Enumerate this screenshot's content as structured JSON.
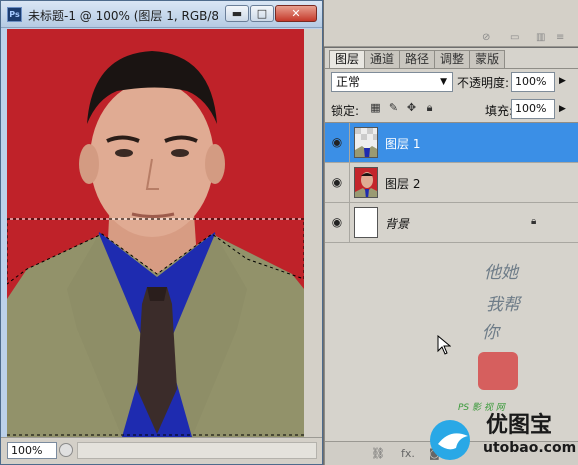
{
  "document": {
    "title": "未标题-1 @ 100% (图层 1, RGB/8...",
    "app_icon": "Ps",
    "zoom": "100%",
    "buttons": {
      "minimize": "▬",
      "maximize": "□",
      "close": "✕"
    }
  },
  "panel": {
    "tabs": [
      "图层",
      "通道",
      "路径",
      "调整",
      "蒙版"
    ],
    "blend_mode": "正常",
    "opacity_label": "不透明度:",
    "opacity_value": "100%",
    "lock_label": "锁定:",
    "fill_label": "填充:",
    "fill_value": "100%",
    "layers": [
      {
        "name": "图层 1",
        "selected": true,
        "visible": true,
        "italic": false,
        "locked": false
      },
      {
        "name": "图层 2",
        "selected": false,
        "visible": true,
        "italic": false,
        "locked": false
      },
      {
        "name": "背景",
        "selected": false,
        "visible": true,
        "italic": true,
        "locked": true
      }
    ],
    "footer_fx": "fx."
  },
  "watermark": {
    "brand": "优图宝",
    "url": "utobao.com",
    "ps_text": "PS 影 视 网"
  },
  "colors": {
    "selected_layer": "#3b8fe6",
    "photo_background": "#c4252b",
    "suit": "#9a9a72",
    "shirt": "#1e2bb0"
  }
}
